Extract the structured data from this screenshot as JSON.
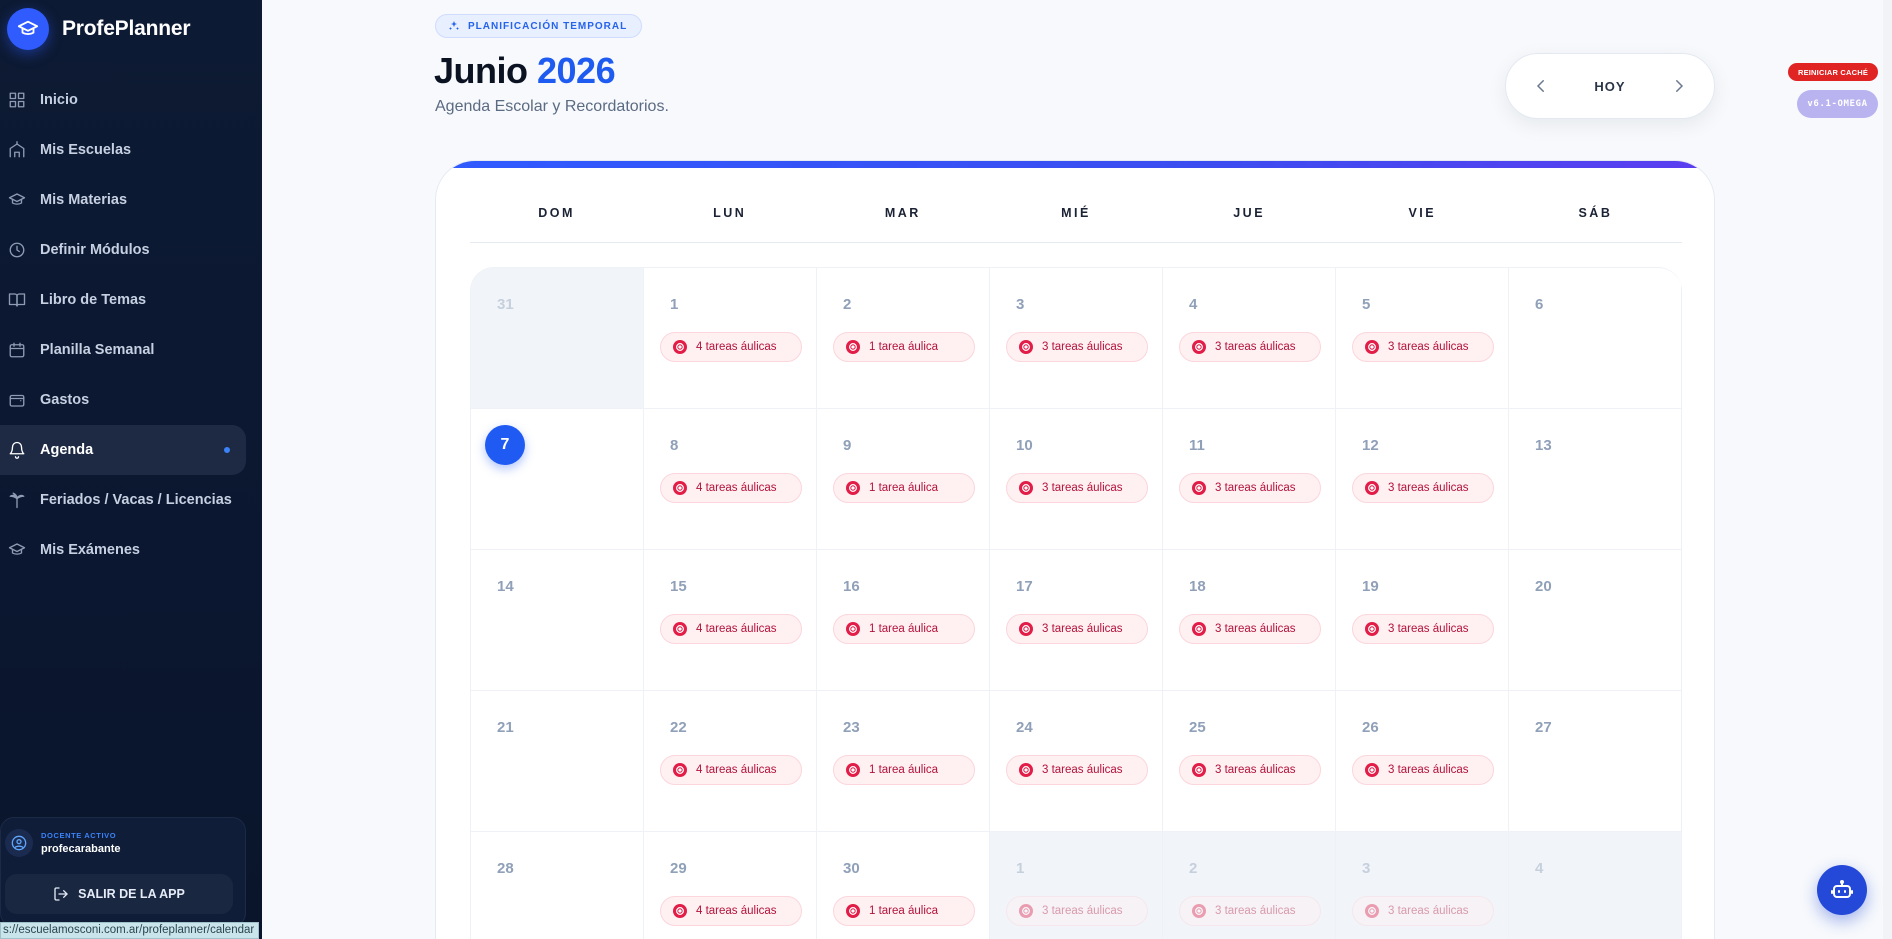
{
  "app": {
    "name": "ProfePlanner",
    "status_url": "s://escuelamosconi.com.ar/profeplanner/calendar"
  },
  "sidebar": {
    "items": [
      {
        "label": "Inicio",
        "icon": "grid-icon",
        "active": false
      },
      {
        "label": "Mis Escuelas",
        "icon": "school-icon",
        "active": false
      },
      {
        "label": "Mis Materias",
        "icon": "graduation-cap-icon",
        "active": false
      },
      {
        "label": "Definir Módulos",
        "icon": "clock-icon",
        "active": false
      },
      {
        "label": "Libro de Temas",
        "icon": "book-icon",
        "active": false
      },
      {
        "label": "Planilla Semanal",
        "icon": "calendar-icon",
        "active": false
      },
      {
        "label": "Gastos",
        "icon": "wallet-icon",
        "active": false
      },
      {
        "label": "Agenda",
        "icon": "bell-icon",
        "active": true
      },
      {
        "label": "Feriados / Vacas / Licencias",
        "icon": "palm-tree-icon",
        "active": false
      },
      {
        "label": "Mis Exámenes",
        "icon": "graduation-cap-icon",
        "active": false
      }
    ],
    "user": {
      "role": "DOCENTE ACTIVO",
      "name": "profecarabante"
    },
    "logout_label": "SALIR DE LA APP"
  },
  "header": {
    "badge": "PLANIFICACIÓN TEMPORAL",
    "month": "Junio",
    "year": "2026",
    "subtitle": "Agenda Escolar y Recordatorios.",
    "today_label": "HOY",
    "reset_cache_label": "REINICIAR CACHÉ",
    "version": "v6.1-OMEGA"
  },
  "calendar": {
    "weekdays": [
      "DOM",
      "LUN",
      "MAR",
      "MIÉ",
      "JUE",
      "VIE",
      "SÁB"
    ],
    "weeks": [
      [
        {
          "day": "31",
          "out": true,
          "tasks": ""
        },
        {
          "day": "1",
          "out": false,
          "tasks": "4 tareas áulicas"
        },
        {
          "day": "2",
          "out": false,
          "tasks": "1 tarea áulica"
        },
        {
          "day": "3",
          "out": false,
          "tasks": "3 tareas áulicas"
        },
        {
          "day": "4",
          "out": false,
          "tasks": "3 tareas áulicas"
        },
        {
          "day": "5",
          "out": false,
          "tasks": "3 tareas áulicas"
        },
        {
          "day": "6",
          "out": false,
          "tasks": ""
        }
      ],
      [
        {
          "day": "7",
          "out": false,
          "today": true,
          "tasks": ""
        },
        {
          "day": "8",
          "out": false,
          "tasks": "4 tareas áulicas"
        },
        {
          "day": "9",
          "out": false,
          "tasks": "1 tarea áulica"
        },
        {
          "day": "10",
          "out": false,
          "tasks": "3 tareas áulicas"
        },
        {
          "day": "11",
          "out": false,
          "tasks": "3 tareas áulicas"
        },
        {
          "day": "12",
          "out": false,
          "tasks": "3 tareas áulicas"
        },
        {
          "day": "13",
          "out": false,
          "tasks": ""
        }
      ],
      [
        {
          "day": "14",
          "out": false,
          "tasks": ""
        },
        {
          "day": "15",
          "out": false,
          "tasks": "4 tareas áulicas"
        },
        {
          "day": "16",
          "out": false,
          "tasks": "1 tarea áulica"
        },
        {
          "day": "17",
          "out": false,
          "tasks": "3 tareas áulicas"
        },
        {
          "day": "18",
          "out": false,
          "tasks": "3 tareas áulicas"
        },
        {
          "day": "19",
          "out": false,
          "tasks": "3 tareas áulicas"
        },
        {
          "day": "20",
          "out": false,
          "tasks": ""
        }
      ],
      [
        {
          "day": "21",
          "out": false,
          "tasks": ""
        },
        {
          "day": "22",
          "out": false,
          "tasks": "4 tareas áulicas"
        },
        {
          "day": "23",
          "out": false,
          "tasks": "1 tarea áulica"
        },
        {
          "day": "24",
          "out": false,
          "tasks": "3 tareas áulicas"
        },
        {
          "day": "25",
          "out": false,
          "tasks": "3 tareas áulicas"
        },
        {
          "day": "26",
          "out": false,
          "tasks": "3 tareas áulicas"
        },
        {
          "day": "27",
          "out": false,
          "tasks": ""
        }
      ],
      [
        {
          "day": "28",
          "out": false,
          "tasks": ""
        },
        {
          "day": "29",
          "out": false,
          "tasks": "4 tareas áulicas"
        },
        {
          "day": "30",
          "out": false,
          "tasks": "1 tarea áulica"
        },
        {
          "day": "1",
          "out": true,
          "tasks": "3 tareas áulicas"
        },
        {
          "day": "2",
          "out": true,
          "tasks": "3 tareas áulicas"
        },
        {
          "day": "3",
          "out": true,
          "tasks": "3 tareas áulicas"
        },
        {
          "day": "4",
          "out": true,
          "tasks": ""
        }
      ]
    ]
  },
  "colors": {
    "accent": "#1f5af3",
    "sidebar_bg": "#0d1a33",
    "task_chip": "#e11d48",
    "reset_cache": "#e02424",
    "version_badge": "#b9b3f0"
  }
}
